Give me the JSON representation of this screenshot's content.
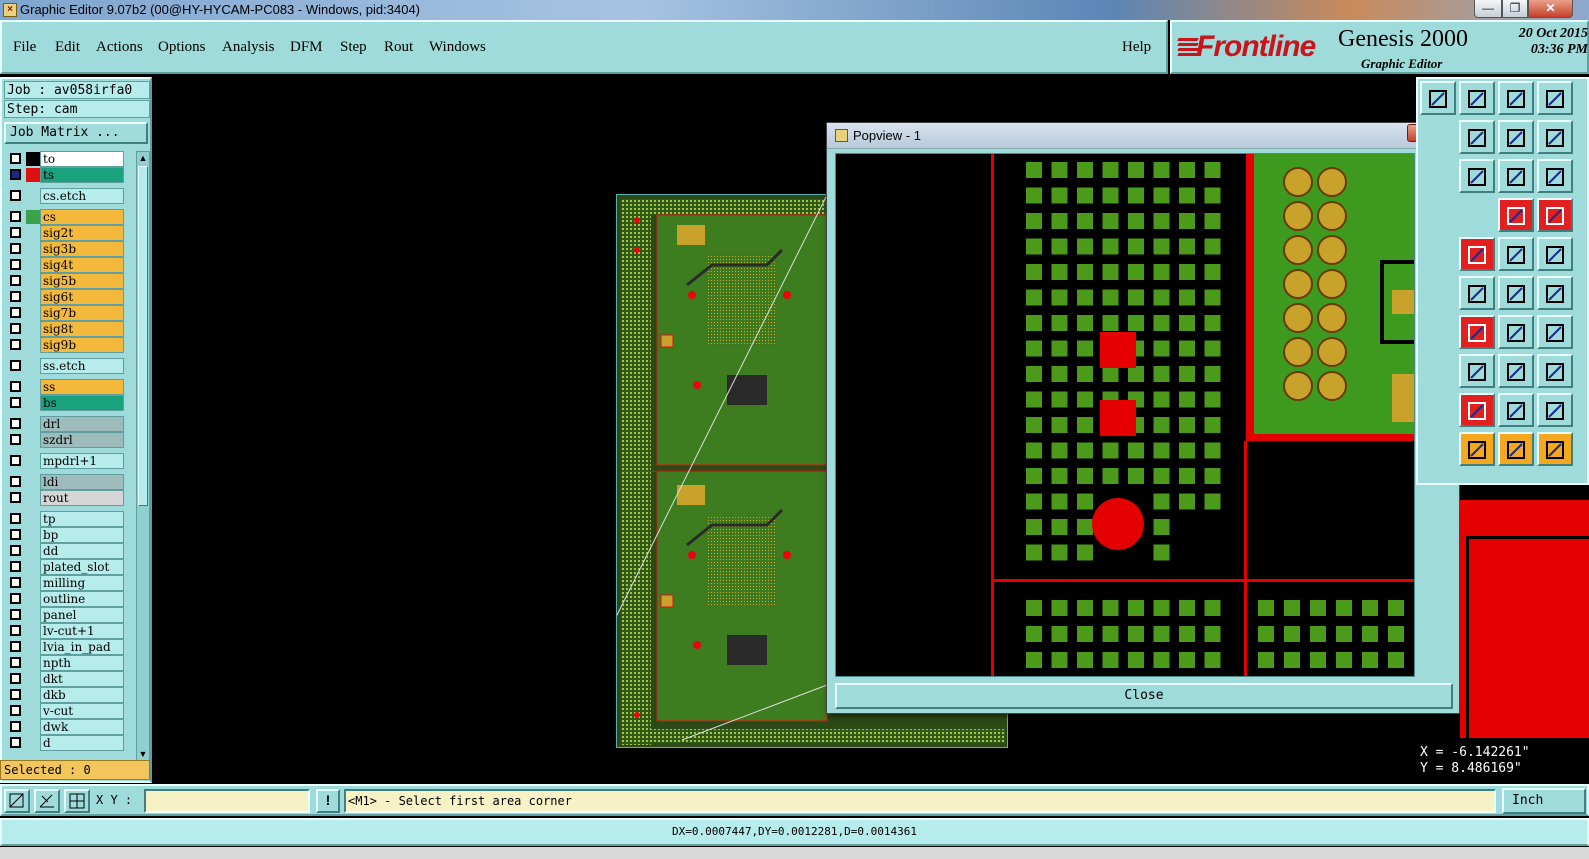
{
  "window": {
    "title": "Graphic Editor 9.07b2 (00@HY-HYCAM-PC083 - Windows, pid:3404)",
    "min_label": "—",
    "max_label": "❐",
    "close_label": "✕"
  },
  "menu": {
    "items": [
      "File",
      "Edit",
      "Actions",
      "Options",
      "Analysis",
      "DFM",
      "Step",
      "Rout",
      "Windows"
    ],
    "help": "Help"
  },
  "brand": {
    "logo_text": "Frontline",
    "product": "Genesis 2000",
    "subtitle": "Graphic Editor",
    "date": "20 Oct 2015",
    "time": "03:36 PM"
  },
  "job": {
    "job_label": "Job : av058irfa0",
    "step_label": "Step: cam",
    "matrix_button": "Job Matrix ..."
  },
  "layers": [
    {
      "name": "to",
      "color": "#ffffff",
      "swatch": "#000000",
      "gap_after": false
    },
    {
      "name": "ts",
      "color": "#1aa17e",
      "swatch": "#e01010",
      "gap_after": true,
      "selected": true
    },
    {
      "name": "cs.etch",
      "color": "#b7ecec",
      "swatch": "",
      "gap_after": true
    },
    {
      "name": "cs",
      "color": "#f4b93a",
      "swatch": "#3aa24a",
      "gap_after": false
    },
    {
      "name": "sig2t",
      "color": "#f4b93a",
      "swatch": "",
      "gap_after": false
    },
    {
      "name": "sig3b",
      "color": "#f4b93a",
      "swatch": "",
      "gap_after": false
    },
    {
      "name": "sig4t",
      "color": "#f4b93a",
      "swatch": "",
      "gap_after": false
    },
    {
      "name": "sig5b",
      "color": "#f4b93a",
      "swatch": "",
      "gap_after": false
    },
    {
      "name": "sig6t",
      "color": "#f4b93a",
      "swatch": "",
      "gap_after": false
    },
    {
      "name": "sig7b",
      "color": "#f4b93a",
      "swatch": "",
      "gap_after": false
    },
    {
      "name": "sig8t",
      "color": "#f4b93a",
      "swatch": "",
      "gap_after": false
    },
    {
      "name": "sig9b",
      "color": "#f4b93a",
      "swatch": "",
      "gap_after": true
    },
    {
      "name": "ss.etch",
      "color": "#b7ecec",
      "swatch": "",
      "gap_after": true
    },
    {
      "name": "ss",
      "color": "#f4b93a",
      "swatch": "",
      "gap_after": false
    },
    {
      "name": "bs",
      "color": "#1aa17e",
      "swatch": "",
      "gap_after": true
    },
    {
      "name": "drl",
      "color": "#9fbcbc",
      "swatch": "",
      "gap_after": false
    },
    {
      "name": "szdrl",
      "color": "#9fbcbc",
      "swatch": "",
      "gap_after": true
    },
    {
      "name": "mpdrl+1",
      "color": "#b7ecec",
      "swatch": "",
      "gap_after": true
    },
    {
      "name": "ldi",
      "color": "#9fbcbc",
      "swatch": "",
      "gap_after": false
    },
    {
      "name": "rout",
      "color": "#d6d6d6",
      "swatch": "",
      "gap_after": true
    },
    {
      "name": "tp",
      "color": "#b7ecec",
      "swatch": "",
      "gap_after": false
    },
    {
      "name": "bp",
      "color": "#b7ecec",
      "swatch": "",
      "gap_after": false
    },
    {
      "name": "dd",
      "color": "#b7ecec",
      "swatch": "",
      "gap_after": false
    },
    {
      "name": "plated_slot",
      "color": "#b7ecec",
      "swatch": "",
      "gap_after": false
    },
    {
      "name": "milling",
      "color": "#b7ecec",
      "swatch": "",
      "gap_after": false
    },
    {
      "name": "outline",
      "color": "#b7ecec",
      "swatch": "",
      "gap_after": false
    },
    {
      "name": "panel",
      "color": "#b7ecec",
      "swatch": "",
      "gap_after": false
    },
    {
      "name": "lv-cut+1",
      "color": "#b7ecec",
      "swatch": "",
      "gap_after": false
    },
    {
      "name": "lvia_in_pad",
      "color": "#b7ecec",
      "swatch": "",
      "gap_after": false
    },
    {
      "name": "npth",
      "color": "#b7ecec",
      "swatch": "",
      "gap_after": false
    },
    {
      "name": "dkt",
      "color": "#b7ecec",
      "swatch": "",
      "gap_after": false
    },
    {
      "name": "dkb",
      "color": "#b7ecec",
      "swatch": "",
      "gap_after": false
    },
    {
      "name": "v-cut",
      "color": "#b7ecec",
      "swatch": "",
      "gap_after": false
    },
    {
      "name": "dwk",
      "color": "#b7ecec",
      "swatch": "",
      "gap_after": false
    },
    {
      "name": "d",
      "color": "#b7ecec",
      "swatch": "",
      "gap_after": false
    }
  ],
  "selected": "Selected : 0",
  "popview": {
    "title": "Popview - 1",
    "close_button": "Close",
    "title_close": "✕"
  },
  "coords": {
    "x": "X = -6.142261\"",
    "y": "Y = 8.486169\""
  },
  "command": {
    "xy_label": "X Y :",
    "xy_value": "",
    "message": "<M1> - Select first area corner",
    "unit": "Inch"
  },
  "status": "DX=0.0007447,DY=0.0012281,D=0.0014361"
}
